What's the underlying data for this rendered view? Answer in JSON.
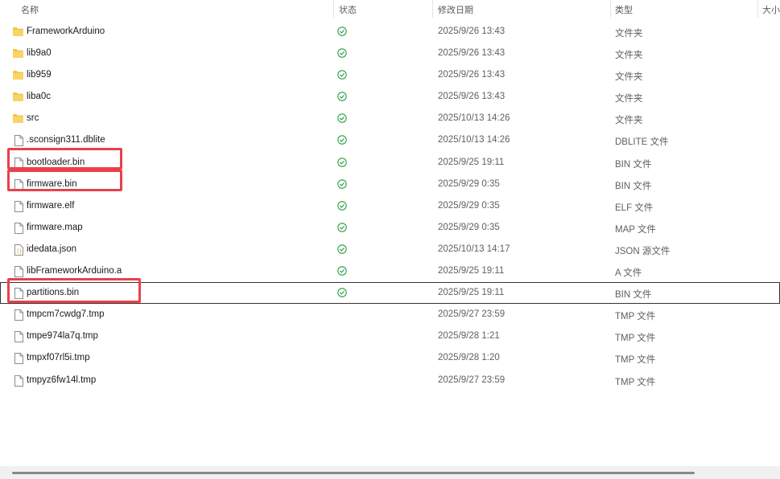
{
  "columns": {
    "name": "名称",
    "status": "状态",
    "modified": "修改日期",
    "type": "类型",
    "size": "大小"
  },
  "files": [
    {
      "name": "FrameworkArduino",
      "icon": "folder-icon",
      "status": "synced",
      "date": "2025/9/26 13:43",
      "type": "文件夹"
    },
    {
      "name": "lib9a0",
      "icon": "folder-icon",
      "status": "synced",
      "date": "2025/9/26 13:43",
      "type": "文件夹"
    },
    {
      "name": "lib959",
      "icon": "folder-icon",
      "status": "synced",
      "date": "2025/9/26 13:43",
      "type": "文件夹"
    },
    {
      "name": "liba0c",
      "icon": "folder-icon",
      "status": "synced",
      "date": "2025/9/26 13:43",
      "type": "文件夹"
    },
    {
      "name": "src",
      "icon": "folder-icon",
      "status": "synced",
      "date": "2025/10/13 14:26",
      "type": "文件夹"
    },
    {
      "name": ".sconsign311.dblite",
      "icon": "file-icon",
      "status": "synced",
      "date": "2025/10/13 14:26",
      "type": "DBLITE 文件"
    },
    {
      "name": "bootloader.bin",
      "icon": "file-icon",
      "status": "synced",
      "date": "2025/9/25 19:11",
      "type": "BIN 文件",
      "highlighted": true
    },
    {
      "name": "firmware.bin",
      "icon": "file-icon",
      "status": "synced",
      "date": "2025/9/29 0:35",
      "type": "BIN 文件",
      "highlighted": true
    },
    {
      "name": "firmware.elf",
      "icon": "file-icon",
      "status": "synced",
      "date": "2025/9/29 0:35",
      "type": "ELF 文件"
    },
    {
      "name": "firmware.map",
      "icon": "file-icon",
      "status": "synced",
      "date": "2025/9/29 0:35",
      "type": "MAP 文件"
    },
    {
      "name": "idedata.json",
      "icon": "json-file-icon",
      "status": "synced",
      "date": "2025/10/13 14:17",
      "type": "JSON 源文件"
    },
    {
      "name": "libFrameworkArduino.a",
      "icon": "file-icon",
      "status": "synced",
      "date": "2025/9/25 19:11",
      "type": "A 文件"
    },
    {
      "name": "partitions.bin",
      "icon": "file-icon",
      "status": "synced",
      "date": "2025/9/25 19:11",
      "type": "BIN 文件",
      "highlighted": true,
      "selected": true
    },
    {
      "name": "tmpcm7cwdg7.tmp",
      "icon": "file-icon",
      "status": "",
      "date": "2025/9/27 23:59",
      "type": "TMP 文件"
    },
    {
      "name": "tmpe974la7q.tmp",
      "icon": "file-icon",
      "status": "",
      "date": "2025/9/28 1:21",
      "type": "TMP 文件"
    },
    {
      "name": "tmpxf07rl5i.tmp",
      "icon": "file-icon",
      "status": "",
      "date": "2025/9/28 1:20",
      "type": "TMP 文件"
    },
    {
      "name": "tmpyz6fw14l.tmp",
      "icon": "file-icon",
      "status": "",
      "date": "2025/9/27 23:59",
      "type": "TMP 文件"
    }
  ],
  "colors": {
    "folder": "#f4c542",
    "status_ok": "#2e9e44",
    "highlight": "#e8414b",
    "selected_outline": "#333333"
  }
}
